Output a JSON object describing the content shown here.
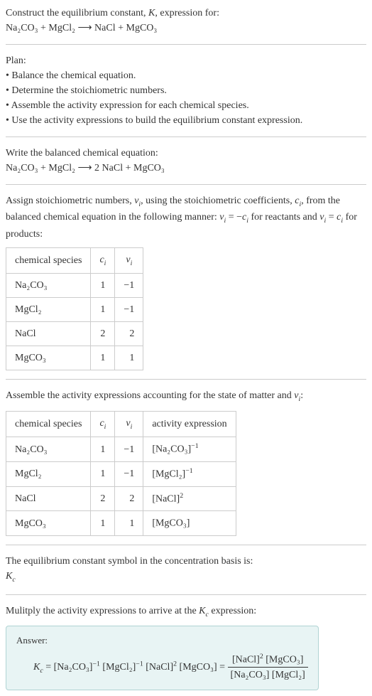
{
  "intro": {
    "line1_prefix": "Construct the equilibrium constant, ",
    "line1_K": "K",
    "line1_suffix": ", expression for:",
    "equation": "Na₂CO₃ + MgCl₂ ⟶ NaCl + MgCO₃"
  },
  "plan": {
    "heading": "Plan:",
    "item1": "• Balance the chemical equation.",
    "item2": "• Determine the stoichiometric numbers.",
    "item3": "• Assemble the activity expression for each chemical species.",
    "item4": "• Use the activity expressions to build the equilibrium constant expression."
  },
  "balanced": {
    "heading": "Write the balanced chemical equation:",
    "equation": "Na₂CO₃ + MgCl₂ ⟶ 2 NaCl + MgCO₃"
  },
  "assign": {
    "text_p1": "Assign stoichiometric numbers, ",
    "nu_i": "ν",
    "i_sub": "i",
    "text_p2": ", using the stoichiometric coefficients, ",
    "c_i": "c",
    "text_p3": ", from the balanced chemical equation in the following manner: ",
    "rel1_a": "ν",
    "rel1_b": " = −",
    "rel1_c": "c",
    "text_p4": " for reactants and ",
    "rel2_a": "ν",
    "rel2_b": " = ",
    "rel2_c": "c",
    "text_p5": " for products:"
  },
  "table1": {
    "h1": "chemical species",
    "h2": "c",
    "h2_sub": "i",
    "h3": "ν",
    "h3_sub": "i",
    "r1": {
      "sp": "Na₂CO₃",
      "c": "1",
      "v": "−1"
    },
    "r2": {
      "sp": "MgCl₂",
      "c": "1",
      "v": "−1"
    },
    "r3": {
      "sp": "NaCl",
      "c": "2",
      "v": "2"
    },
    "r4": {
      "sp": "MgCO₃",
      "c": "1",
      "v": "1"
    }
  },
  "assemble": {
    "text_p1": "Assemble the activity expressions accounting for the state of matter and ",
    "nu": "ν",
    "i_sub": "i",
    "colon": ":"
  },
  "table2": {
    "h1": "chemical species",
    "h2": "c",
    "h2_sub": "i",
    "h3": "ν",
    "h3_sub": "i",
    "h4": "activity expression",
    "r1": {
      "sp": "Na₂CO₃",
      "c": "1",
      "v": "−1",
      "a_base": "[Na₂CO₃]",
      "a_exp": "−1"
    },
    "r2": {
      "sp": "MgCl₂",
      "c": "1",
      "v": "−1",
      "a_base": "[MgCl₂]",
      "a_exp": "−1"
    },
    "r3": {
      "sp": "NaCl",
      "c": "2",
      "v": "2",
      "a_base": "[NaCl]",
      "a_exp": "2"
    },
    "r4": {
      "sp": "MgCO₃",
      "c": "1",
      "v": "1",
      "a_base": "[MgCO₃]",
      "a_exp": ""
    }
  },
  "eqconst": {
    "line1": "The equilibrium constant symbol in the concentration basis is:",
    "K": "K",
    "c_sub": "c"
  },
  "multiply": {
    "text_p1": "Mulitply the activity expressions to arrive at the ",
    "K": "K",
    "c_sub": "c",
    "text_p2": " expression:"
  },
  "answer": {
    "label": "Answer:",
    "K": "K",
    "c_sub": "c",
    "eq": " = ",
    "t1_base": "[Na₂CO₃]",
    "t1_exp": "−1",
    "t2_base": "[MgCl₂]",
    "t2_exp": "−1",
    "t3_base": "[NaCl]",
    "t3_exp": "2",
    "t4_base": "[MgCO₃]",
    "eq2": " = ",
    "num_a_base": "[NaCl]",
    "num_a_exp": "2",
    "num_b": "[MgCO₃]",
    "den_a": "[Na₂CO₃]",
    "den_b": "[MgCl₂]"
  }
}
